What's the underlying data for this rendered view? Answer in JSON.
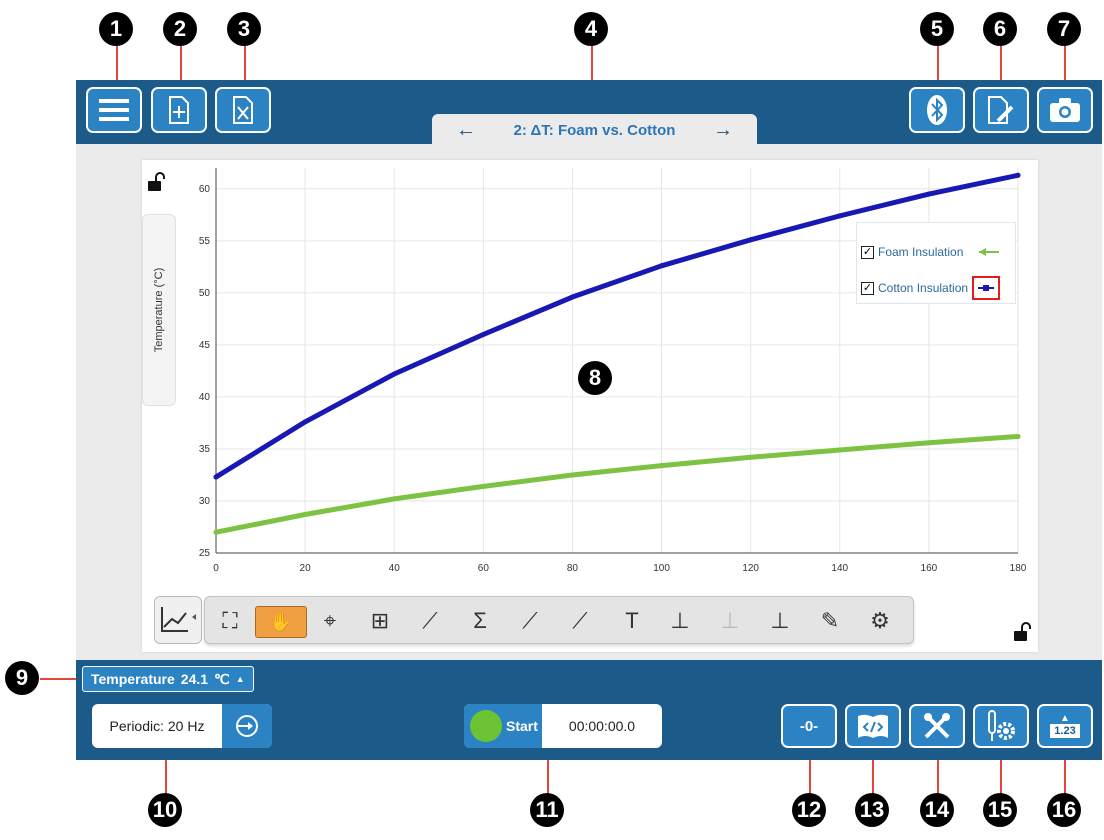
{
  "callouts": [
    "1",
    "2",
    "3",
    "4",
    "5",
    "6",
    "7",
    "8",
    "9",
    "10",
    "11",
    "12",
    "13",
    "14",
    "15",
    "16"
  ],
  "toolbar": {
    "menu_icon": "hamburger-menu-icon",
    "new_file_icon": "new-file-icon",
    "close_file_icon": "close-file-icon",
    "bluetooth_icon": "bluetooth-icon",
    "annotate_icon": "document-pen-icon",
    "camera_icon": "camera-icon"
  },
  "page_tab": {
    "title": "2: ΔT: Foam vs. Cotton",
    "prev_icon": "arrow-left-icon",
    "next_icon": "arrow-right-icon"
  },
  "chart_data": {
    "type": "line",
    "ylabel": "Temperature (°C)",
    "xlim": [
      0,
      180
    ],
    "ylim": [
      25,
      62
    ],
    "x_ticks": [
      "0",
      "20",
      "40",
      "60",
      "80",
      "100",
      "120",
      "140",
      "160",
      "180"
    ],
    "y_ticks": [
      "25",
      "30",
      "35",
      "40",
      "45",
      "50",
      "55",
      "60"
    ],
    "grid": true,
    "legend_position": "top-right",
    "series": [
      {
        "name": "Cotton Insulation",
        "color": "#1818b4",
        "marker": "square",
        "x": [
          0,
          20,
          40,
          60,
          80,
          100,
          120,
          140,
          160,
          180
        ],
        "y": [
          32.3,
          37.6,
          42.2,
          46.0,
          49.6,
          52.6,
          55.1,
          57.4,
          59.5,
          61.3
        ]
      },
      {
        "name": "Foam Insulation",
        "color": "#7dc242",
        "marker": "arrow-left",
        "x": [
          0,
          20,
          40,
          60,
          80,
          100,
          120,
          140,
          160,
          180
        ],
        "y": [
          27.0,
          28.7,
          30.2,
          31.4,
          32.5,
          33.4,
          34.2,
          34.9,
          35.6,
          36.2
        ]
      }
    ]
  },
  "graph_tools": {
    "graph_options_icon": "graph-options-icon",
    "tools": [
      {
        "name": "autoscale-icon",
        "glyph": "⛶"
      },
      {
        "name": "pan-select-icon",
        "glyph": "✋"
      },
      {
        "name": "examine-icon",
        "glyph": "⌖"
      },
      {
        "name": "tangent-icon",
        "glyph": "⊞"
      },
      {
        "name": "curve-fit-icon",
        "glyph": "⟋"
      },
      {
        "name": "statistics-icon",
        "glyph": "Σ"
      },
      {
        "name": "linear-fit-icon",
        "glyph": "⟋"
      },
      {
        "name": "curve-fit-scatter-icon",
        "glyph": "⟋"
      },
      {
        "name": "annotation-text-icon",
        "glyph": "T"
      },
      {
        "name": "add-y-axis-icon",
        "glyph": "⊥"
      },
      {
        "name": "remove-y-axis-icon",
        "glyph": "⊥"
      },
      {
        "name": "add-plot-icon",
        "glyph": "⊥"
      },
      {
        "name": "draw-prediction-icon",
        "glyph": "✎"
      },
      {
        "name": "settings-gear-icon",
        "glyph": "⚙"
      }
    ]
  },
  "meter": {
    "label": "Temperature",
    "value": "24.1",
    "unit": "℃",
    "caret": "▲"
  },
  "sampling": {
    "mode": "Periodic: 20 Hz",
    "icon": "sampling-options-icon"
  },
  "collection": {
    "start_label": "Start",
    "timer": "00:00:00.0"
  },
  "bottom_tools": {
    "zero_label": "-0-",
    "code_icon": "code-journal-icon",
    "tools_icon": "wrench-screwdriver-icon",
    "sensor_settings_icon": "sensor-gear-icon",
    "meter_label": "1.23"
  }
}
